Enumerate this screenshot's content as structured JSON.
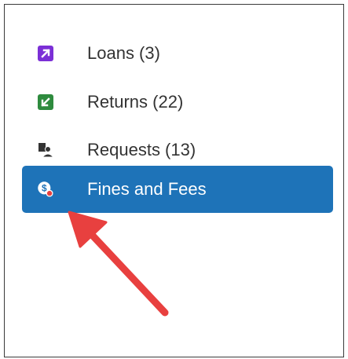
{
  "nav": {
    "items": [
      {
        "label": "Loans (3)",
        "icon": "loan-arrow-icon",
        "icon_color": "#7b2fd6"
      },
      {
        "label": "Returns (22)",
        "icon": "return-arrow-icon",
        "icon_color": "#2e8b3e"
      },
      {
        "label": "Requests (13)",
        "icon": "requests-person-icon",
        "icon_color": "#333333"
      },
      {
        "label": "Fines and Fees",
        "icon": "dollar-fees-icon",
        "icon_color": "#ffffff",
        "active": true
      }
    ]
  },
  "colors": {
    "active_background": "#1e73b8",
    "annotation_arrow": "#e8403f",
    "notification_dot": "#e8403f"
  },
  "annotation": {
    "icon": "pointer-arrow-icon"
  }
}
